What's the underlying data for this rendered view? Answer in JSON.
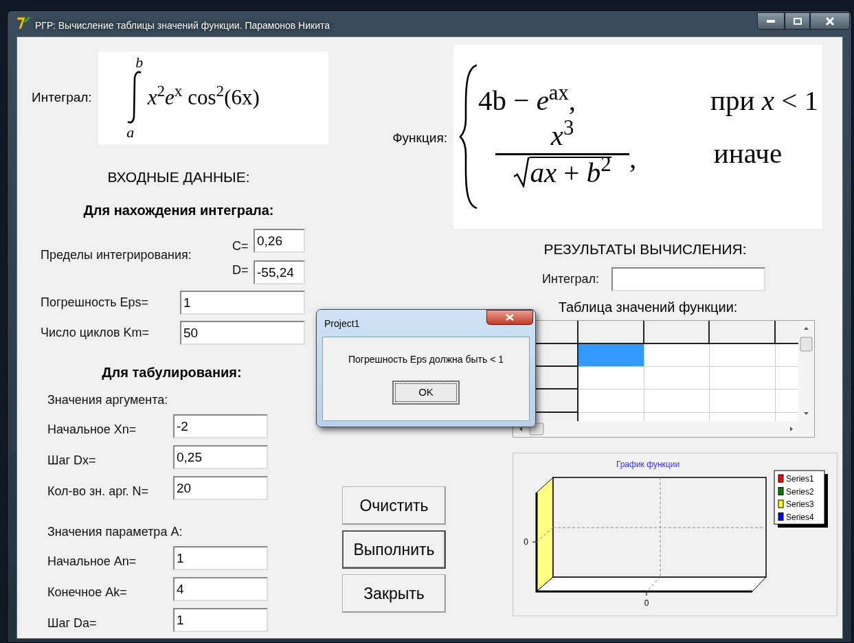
{
  "window": {
    "title": "РГР: Вычисление таблицы значений функции. Парамонов Никита"
  },
  "integral": {
    "label": "Интеграл:",
    "upper": "b",
    "lower": "a",
    "integrand": "*x*$^{2}$*e*$^{x}$ cos$^{2}$(6x)"
  },
  "function": {
    "label": "Функция:",
    "cases": [
      {
        "kind": "plain",
        "expr": "4b − *e*$^{ax}$,",
        "condition": "при *x* < 1"
      },
      {
        "kind": "fraction",
        "numerator": "*x*$^{3}$",
        "radicand": "*ax* + *b*$^{2}$",
        "suffix": ",",
        "condition": "иначе"
      }
    ]
  },
  "inputs": {
    "title": "ВХОДНЫЕ ДАННЫЕ:",
    "integral_section": {
      "title": "Для нахождения интеграла:",
      "limits_label": "Пределы интегрирования:",
      "limits": [
        {
          "label": "C=",
          "value": "0,26"
        },
        {
          "label": "D=",
          "value": "-55,24"
        }
      ],
      "fields": [
        {
          "label": "Погрешность Eps=",
          "value": "1"
        },
        {
          "label": "Число циклов Km=",
          "value": "50"
        }
      ]
    },
    "tabulation": {
      "title": "Для табулирования:",
      "groups": [
        {
          "title": "Значения аргумента:",
          "fields": [
            {
              "label": "Начальное Xn=",
              "value": "-2"
            },
            {
              "label": "Шаг Dx=",
              "value": "0,25"
            },
            {
              "label": "Кол-во зн. арг. N=",
              "value": "20"
            }
          ]
        },
        {
          "title": "Значения параметра A:",
          "fields": [
            {
              "label": "Начальное An=",
              "value": "1"
            },
            {
              "label": "Конечное Ak=",
              "value": "4"
            },
            {
              "label": "Шаг Da=",
              "value": "1"
            }
          ]
        }
      ]
    }
  },
  "buttons": [
    {
      "label": "Очистить",
      "default": false
    },
    {
      "label": "Выполнить",
      "default": true
    },
    {
      "label": "Закрыть",
      "default": false
    }
  ],
  "results": {
    "title": "РЕЗУЛЬТАТЫ ВЫЧИСЛЕНИЯ:",
    "integral": {
      "label": "Интеграл:"
    },
    "table_title": "Таблица значений функции:",
    "grid": {
      "rows": [
        {
          "kind": "header"
        },
        {
          "kind": "data",
          "cells": [
            {
              "selected": true
            },
            {
              "selected": false
            },
            {
              "selected": false
            },
            {
              "selected": false
            }
          ]
        },
        {
          "kind": "data",
          "cells": [
            {
              "selected": false
            },
            {
              "selected": false
            },
            {
              "selected": false
            },
            {
              "selected": false
            }
          ]
        },
        {
          "kind": "data",
          "cells": [
            {
              "selected": false
            },
            {
              "selected": false
            },
            {
              "selected": false
            },
            {
              "selected": false
            }
          ]
        },
        {
          "kind": "data",
          "cells": [
            {
              "selected": false
            },
            {
              "selected": false
            },
            {
              "selected": false
            },
            {
              "selected": false
            }
          ]
        }
      ]
    }
  },
  "chart": {
    "title": "График функции",
    "y_tick": "0",
    "x_tick": "0",
    "legend": [
      {
        "label": "Series1",
        "color": "#ff0000"
      },
      {
        "label": "Series2",
        "color": "#008000"
      },
      {
        "label": "Series3",
        "color": "#ffff00"
      },
      {
        "label": "Series4",
        "color": "#0000ff"
      }
    ]
  },
  "dialog": {
    "title": "Project1",
    "message": "Погрешность Eps должна быть < 1",
    "button": "OK"
  }
}
